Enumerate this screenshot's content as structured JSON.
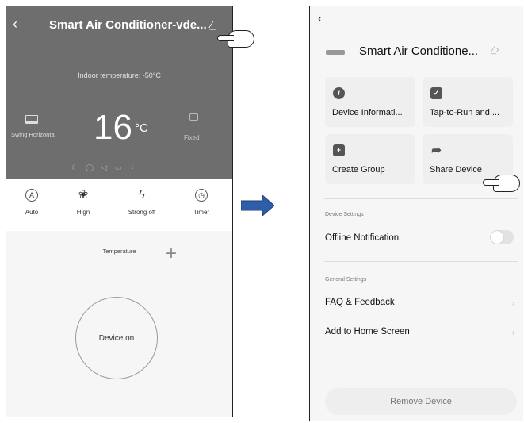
{
  "left": {
    "back_icon": "chevron-left-icon",
    "title": "Smart Air Conditioner-vde...",
    "edit_icon": "pencil-icon",
    "indoor_temperature": "Indoor temperature: -50°C",
    "swing_label": "Swing Horizontal",
    "temperature_value": "16",
    "temperature_unit": "°C",
    "fixed_label": "Fixed",
    "modes": [
      {
        "label": "Auto",
        "icon": "A"
      },
      {
        "label": "Hign",
        "icon": "fan-icon"
      },
      {
        "label": "Strong off",
        "icon": "bolt-icon"
      },
      {
        "label": "Timer",
        "icon": "clock-icon"
      }
    ],
    "temperature_label": "Temperature",
    "power_label": "Device on"
  },
  "right": {
    "back_icon": "chevron-left-icon",
    "device_name": "Smart Air Conditione...",
    "cards": [
      {
        "label": "Device Informati...",
        "icon": "info-icon"
      },
      {
        "label": "Tap-to-Run and ...",
        "icon": "check-shield-icon"
      },
      {
        "label": "Create Group",
        "icon": "add-group-icon"
      },
      {
        "label": "Share Device",
        "icon": "share-icon"
      }
    ],
    "device_settings_header": "Device Settings",
    "offline_notification": "Offline Notification",
    "offline_notification_enabled": false,
    "general_settings_header": "General Settings",
    "faq": "FAQ & Feedback",
    "add_home": "Add to Home Screen",
    "remove_device": "Remove Device"
  },
  "colors": {
    "header_gray": "#6e6e6e",
    "arrow_blue": "#2f5ea8"
  }
}
